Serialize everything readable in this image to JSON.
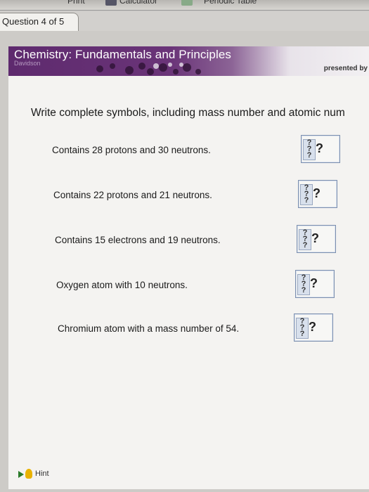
{
  "toolbar": {
    "items": [
      {
        "label": "Print"
      },
      {
        "label": "Calculator"
      },
      {
        "label": "Periodic Table"
      }
    ]
  },
  "question": {
    "tab_label": "Question 4 of 5"
  },
  "banner": {
    "title": "Chemistry: Fundamentals and Principles",
    "author": "Davidson",
    "presented_by": "presented by"
  },
  "instruction": "Write complete symbols, including mass number and atomic num",
  "items": [
    {
      "text": "Contains 28 protons and 30 neutrons.",
      "placeholder": "?"
    },
    {
      "text": "Contains 22 protons and 21 neutrons.",
      "placeholder": "?"
    },
    {
      "text": "Contains 15 electrons and 19 neutrons.",
      "placeholder": "?"
    },
    {
      "text": "Oxygen atom with 10 neutrons.",
      "placeholder": "?"
    },
    {
      "text": "Chromium atom with a mass number of 54.",
      "placeholder": "?"
    }
  ],
  "hint": {
    "label": "Hint"
  }
}
